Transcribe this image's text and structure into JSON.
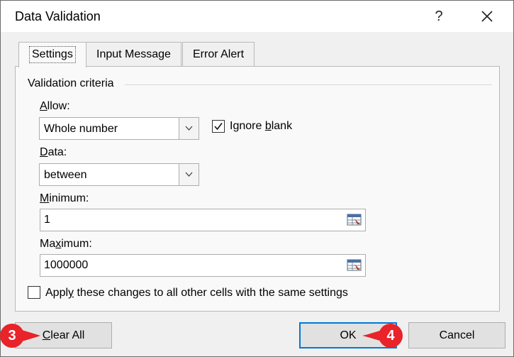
{
  "dialog": {
    "title": "Data Validation",
    "help_label": "?",
    "close_icon": "close-icon"
  },
  "tabs": [
    {
      "label": "Settings",
      "active": true
    },
    {
      "label": "Input Message",
      "active": false
    },
    {
      "label": "Error Alert",
      "active": false
    }
  ],
  "validation": {
    "group_label": "Validation criteria",
    "allow": {
      "label_u": "A",
      "label_rest": "llow:",
      "value": "Whole number"
    },
    "ignore_blank": {
      "label_pre": "Ignore ",
      "label_u": "b",
      "label_rest": "lank",
      "checked": true
    },
    "data": {
      "label_u": "D",
      "label_rest": "ata:",
      "value": "between"
    },
    "minimum": {
      "label_u": "M",
      "label_rest": "inimum:",
      "value": "1"
    },
    "maximum": {
      "label_pre": "Ma",
      "label_u": "x",
      "label_rest": "imum:",
      "value": "1000000"
    }
  },
  "apply_changes": {
    "label_pre": "Appl",
    "label_u": "y",
    "label_rest": " these changes to all other cells with the same settings",
    "checked": false
  },
  "buttons": {
    "clear_all_u": "C",
    "clear_all_rest": "lear All",
    "ok": "OK",
    "cancel": "Cancel"
  },
  "callouts": [
    {
      "number": "3",
      "color": "#e8232a"
    },
    {
      "number": "4",
      "color": "#e8232a"
    }
  ]
}
